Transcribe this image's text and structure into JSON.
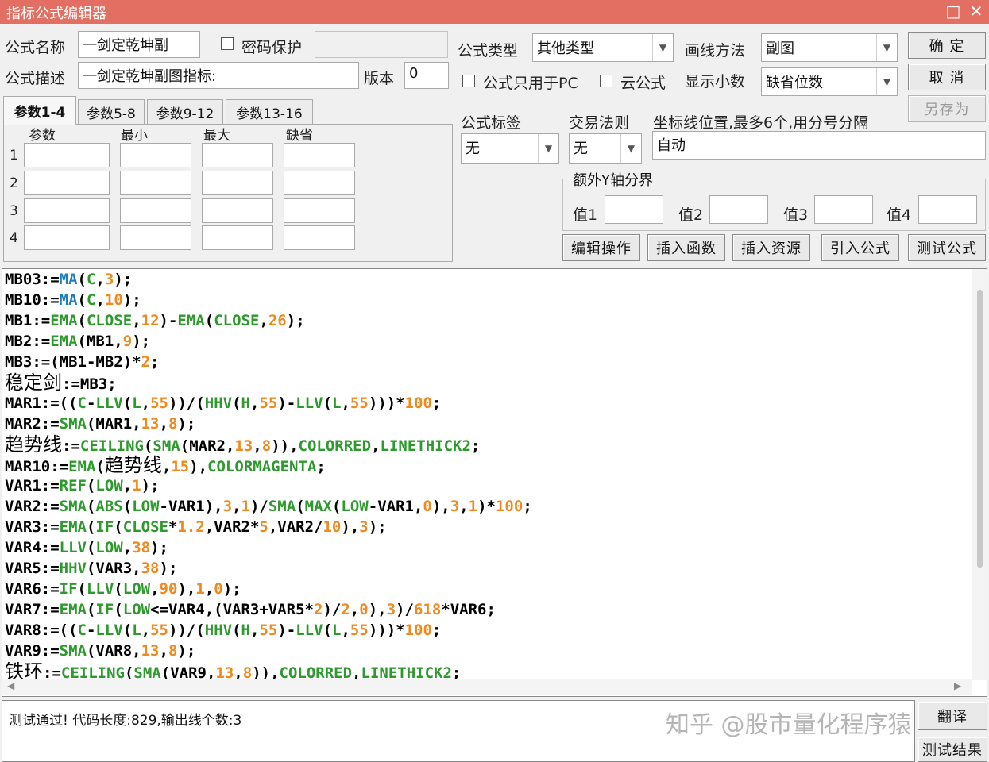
{
  "window": {
    "title": "指标公式编辑器",
    "btn_max": "□",
    "btn_close": "✕"
  },
  "form": {
    "name_label": "公式名称",
    "name_value": "一剑定乾坤副",
    "password_label": "密码保护",
    "desc_label": "公式描述",
    "desc_value": "一剑定乾坤副图指标:",
    "version_label": "版本",
    "version_value": "0",
    "type_label": "公式类型",
    "type_value": "其他类型",
    "draw_label": "画线方法",
    "draw_value": "副图",
    "pc_only_label": "公式只用于PC",
    "cloud_label": "云公式",
    "decimals_label": "显示小数",
    "decimals_value": "缺省位数",
    "tag_label": "公式标签",
    "tag_value": "无",
    "rule_label": "交易法则",
    "rule_value": "无",
    "coord_label": "坐标线位置,最多6个,用分号分隔",
    "coord_value": "自动",
    "extra_y_title": "额外Y轴分界",
    "val1": "值1",
    "val2": "值2",
    "val3": "值3",
    "val4": "值4"
  },
  "buttons": {
    "ok": "确 定",
    "cancel": "取 消",
    "save_as": "另存为",
    "edit_ops": "编辑操作",
    "insert_fn": "插入函数",
    "insert_res": "插入资源",
    "import": "引入公式",
    "test": "测试公式",
    "translate": "翻译",
    "test_result": "测试结果"
  },
  "tabs": [
    "参数1-4",
    "参数5-8",
    "参数9-12",
    "参数13-16"
  ],
  "param_grid": {
    "headers": [
      "参数",
      "最小",
      "最大",
      "缺省"
    ],
    "rows": [
      "1",
      "2",
      "3",
      "4"
    ]
  },
  "code_lines": [
    [
      [
        "t",
        "MB03:="
      ],
      [
        "f2",
        "MA"
      ],
      [
        "t",
        "("
      ],
      [
        "f",
        "C"
      ],
      [
        "t",
        ","
      ],
      [
        "n",
        "3"
      ],
      [
        "t",
        ");"
      ]
    ],
    [
      [
        "t",
        "MB10:="
      ],
      [
        "f2",
        "MA"
      ],
      [
        "t",
        "("
      ],
      [
        "f",
        "C"
      ],
      [
        "t",
        ","
      ],
      [
        "n",
        "10"
      ],
      [
        "t",
        ");"
      ]
    ],
    [
      [
        "t",
        "MB1:="
      ],
      [
        "f",
        "EMA"
      ],
      [
        "t",
        "("
      ],
      [
        "f",
        "CLOSE"
      ],
      [
        "t",
        ","
      ],
      [
        "n",
        "12"
      ],
      [
        "t",
        ")-"
      ],
      [
        "f",
        "EMA"
      ],
      [
        "t",
        "("
      ],
      [
        "f",
        "CLOSE"
      ],
      [
        "t",
        ","
      ],
      [
        "n",
        "26"
      ],
      [
        "t",
        ");"
      ]
    ],
    [
      [
        "t",
        "MB2:="
      ],
      [
        "f",
        "EMA"
      ],
      [
        "t",
        "(MB1,"
      ],
      [
        "n",
        "9"
      ],
      [
        "t",
        ");"
      ]
    ],
    [
      [
        "t",
        "MB3:=(MB1-MB2)*"
      ],
      [
        "n",
        "2"
      ],
      [
        "t",
        ";"
      ]
    ],
    [
      [
        "c",
        "稳定剑"
      ],
      [
        "t",
        ":=MB3;"
      ]
    ],
    [
      [
        "t",
        "MAR1:=(("
      ],
      [
        "f",
        "C"
      ],
      [
        "t",
        "-"
      ],
      [
        "f",
        "LLV"
      ],
      [
        "t",
        "("
      ],
      [
        "f",
        "L"
      ],
      [
        "t",
        ","
      ],
      [
        "n",
        "55"
      ],
      [
        "t",
        "))/("
      ],
      [
        "f",
        "HHV"
      ],
      [
        "t",
        "("
      ],
      [
        "f",
        "H"
      ],
      [
        "t",
        ","
      ],
      [
        "n",
        "55"
      ],
      [
        "t",
        ")-"
      ],
      [
        "f",
        "LLV"
      ],
      [
        "t",
        "("
      ],
      [
        "f",
        "L"
      ],
      [
        "t",
        ","
      ],
      [
        "n",
        "55"
      ],
      [
        "t",
        ")))*"
      ],
      [
        "n",
        "100"
      ],
      [
        "t",
        ";"
      ]
    ],
    [
      [
        "t",
        "MAR2:="
      ],
      [
        "f",
        "SMA"
      ],
      [
        "t",
        "(MAR1,"
      ],
      [
        "n",
        "13"
      ],
      [
        "t",
        ","
      ],
      [
        "n",
        "8"
      ],
      [
        "t",
        ");"
      ]
    ],
    [
      [
        "c",
        "趋势线"
      ],
      [
        "t",
        ":="
      ],
      [
        "f",
        "CEILING"
      ],
      [
        "t",
        "("
      ],
      [
        "f",
        "SMA"
      ],
      [
        "t",
        "(MAR2,"
      ],
      [
        "n",
        "13"
      ],
      [
        "t",
        ","
      ],
      [
        "n",
        "8"
      ],
      [
        "t",
        "))"
      ],
      [
        "t",
        ","
      ],
      [
        "f",
        "COLORRED"
      ],
      [
        "t",
        ","
      ],
      [
        "f",
        "LINETHICK2"
      ],
      [
        "t",
        ";"
      ]
    ],
    [
      [
        "t",
        "MAR10:="
      ],
      [
        "f",
        "EMA"
      ],
      [
        "t",
        "("
      ],
      [
        "c",
        "趋势线"
      ],
      [
        "t",
        ","
      ],
      [
        "n",
        "15"
      ],
      [
        "t",
        ")"
      ],
      [
        "t",
        ","
      ],
      [
        "f",
        "COLORMAGENTA"
      ],
      [
        "t",
        ";"
      ]
    ],
    [
      [
        "t",
        "VAR1:="
      ],
      [
        "f",
        "REF"
      ],
      [
        "t",
        "("
      ],
      [
        "f",
        "LOW"
      ],
      [
        "t",
        ","
      ],
      [
        "n",
        "1"
      ],
      [
        "t",
        ");"
      ]
    ],
    [
      [
        "t",
        "VAR2:="
      ],
      [
        "f",
        "SMA"
      ],
      [
        "t",
        "("
      ],
      [
        "f",
        "ABS"
      ],
      [
        "t",
        "("
      ],
      [
        "f",
        "LOW"
      ],
      [
        "t",
        "-VAR1),"
      ],
      [
        "n",
        "3"
      ],
      [
        "t",
        ","
      ],
      [
        "n",
        "1"
      ],
      [
        "t",
        ")/"
      ],
      [
        "f",
        "SMA"
      ],
      [
        "t",
        "("
      ],
      [
        "f",
        "MAX"
      ],
      [
        "t",
        "("
      ],
      [
        "f",
        "LOW"
      ],
      [
        "t",
        "-VAR1,"
      ],
      [
        "n",
        "0"
      ],
      [
        "t",
        "),"
      ],
      [
        "n",
        "3"
      ],
      [
        "t",
        ","
      ],
      [
        "n",
        "1"
      ],
      [
        "t",
        ")*"
      ],
      [
        "n",
        "100"
      ],
      [
        "t",
        ";"
      ]
    ],
    [
      [
        "t",
        "VAR3:="
      ],
      [
        "f",
        "EMA"
      ],
      [
        "t",
        "("
      ],
      [
        "f",
        "IF"
      ],
      [
        "t",
        "("
      ],
      [
        "f",
        "CLOSE"
      ],
      [
        "t",
        "*"
      ],
      [
        "n",
        "1.2"
      ],
      [
        "t",
        ",VAR2*"
      ],
      [
        "n",
        "5"
      ],
      [
        "t",
        ",VAR2/"
      ],
      [
        "n",
        "10"
      ],
      [
        "t",
        "),"
      ],
      [
        "n",
        "3"
      ],
      [
        "t",
        ");"
      ]
    ],
    [
      [
        "t",
        "VAR4:="
      ],
      [
        "f",
        "LLV"
      ],
      [
        "t",
        "("
      ],
      [
        "f",
        "LOW"
      ],
      [
        "t",
        ","
      ],
      [
        "n",
        "38"
      ],
      [
        "t",
        ");"
      ]
    ],
    [
      [
        "t",
        "VAR5:="
      ],
      [
        "f",
        "HHV"
      ],
      [
        "t",
        "(VAR3,"
      ],
      [
        "n",
        "38"
      ],
      [
        "t",
        ");"
      ]
    ],
    [
      [
        "t",
        "VAR6:="
      ],
      [
        "f",
        "IF"
      ],
      [
        "t",
        "("
      ],
      [
        "f",
        "LLV"
      ],
      [
        "t",
        "("
      ],
      [
        "f",
        "LOW"
      ],
      [
        "t",
        ","
      ],
      [
        "n",
        "90"
      ],
      [
        "t",
        "),"
      ],
      [
        "n",
        "1"
      ],
      [
        "t",
        ","
      ],
      [
        "n",
        "0"
      ],
      [
        "t",
        ");"
      ]
    ],
    [
      [
        "t",
        "VAR7:="
      ],
      [
        "f",
        "EMA"
      ],
      [
        "t",
        "("
      ],
      [
        "f",
        "IF"
      ],
      [
        "t",
        "("
      ],
      [
        "f",
        "LOW"
      ],
      [
        "t",
        "<=VAR4,(VAR3+VAR5*"
      ],
      [
        "n",
        "2"
      ],
      [
        "t",
        ")/"
      ],
      [
        "n",
        "2"
      ],
      [
        "t",
        ","
      ],
      [
        "n",
        "0"
      ],
      [
        "t",
        "),"
      ],
      [
        "n",
        "3"
      ],
      [
        "t",
        ")/"
      ],
      [
        "n",
        "618"
      ],
      [
        "t",
        "*VAR6;"
      ]
    ],
    [
      [
        "t",
        "VAR8:=(("
      ],
      [
        "f",
        "C"
      ],
      [
        "t",
        "-"
      ],
      [
        "f",
        "LLV"
      ],
      [
        "t",
        "("
      ],
      [
        "f",
        "L"
      ],
      [
        "t",
        ","
      ],
      [
        "n",
        "55"
      ],
      [
        "t",
        "))/("
      ],
      [
        "f",
        "HHV"
      ],
      [
        "t",
        "("
      ],
      [
        "f",
        "H"
      ],
      [
        "t",
        ","
      ],
      [
        "n",
        "55"
      ],
      [
        "t",
        ")-"
      ],
      [
        "f",
        "LLV"
      ],
      [
        "t",
        "("
      ],
      [
        "f",
        "L"
      ],
      [
        "t",
        ","
      ],
      [
        "n",
        "55"
      ],
      [
        "t",
        ")))*"
      ],
      [
        "n",
        "100"
      ],
      [
        "t",
        ";"
      ]
    ],
    [
      [
        "t",
        "VAR9:="
      ],
      [
        "f",
        "SMA"
      ],
      [
        "t",
        "(VAR8,"
      ],
      [
        "n",
        "13"
      ],
      [
        "t",
        ","
      ],
      [
        "n",
        "8"
      ],
      [
        "t",
        ");"
      ]
    ],
    [
      [
        "c",
        "铁环"
      ],
      [
        "t",
        ":="
      ],
      [
        "f",
        "CEILING"
      ],
      [
        "t",
        "("
      ],
      [
        "f",
        "SMA"
      ],
      [
        "t",
        "(VAR9,"
      ],
      [
        "n",
        "13"
      ],
      [
        "t",
        ","
      ],
      [
        "n",
        "8"
      ],
      [
        "t",
        "))"
      ],
      [
        "t",
        ","
      ],
      [
        "f",
        "COLORRED"
      ],
      [
        "t",
        ","
      ],
      [
        "f",
        "LINETHICK2"
      ],
      [
        "t",
        ";"
      ]
    ]
  ],
  "status_text": "测试通过! 代码长度:829,输出线个数:3",
  "watermark": "知乎 @股市量化程序猿"
}
